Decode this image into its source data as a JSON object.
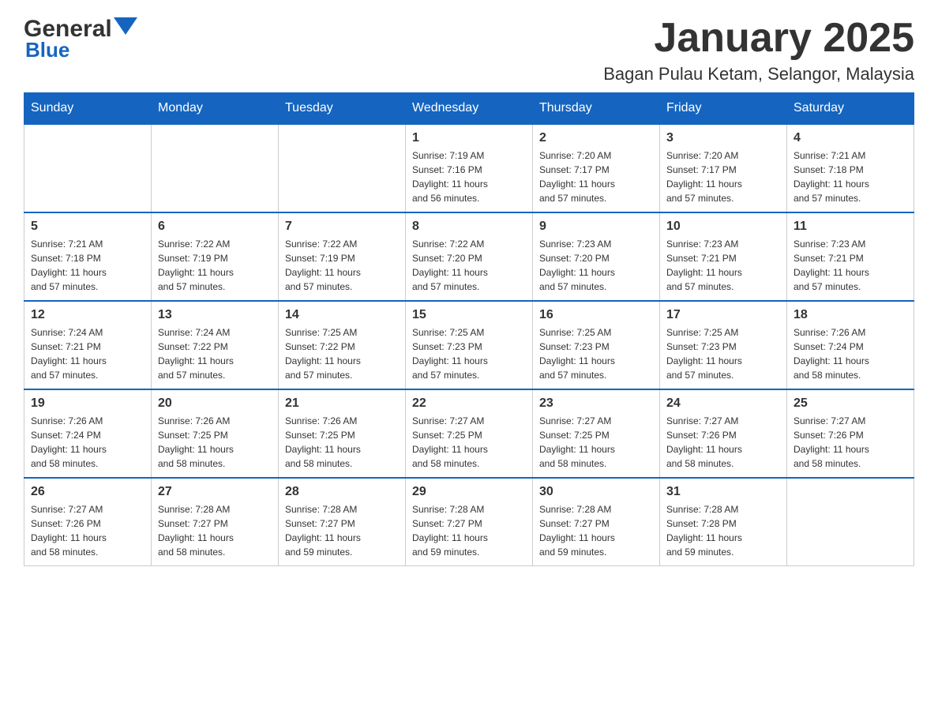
{
  "header": {
    "logo_general": "General",
    "logo_blue": "Blue",
    "title": "January 2025",
    "subtitle": "Bagan Pulau Ketam, Selangor, Malaysia"
  },
  "weekdays": [
    "Sunday",
    "Monday",
    "Tuesday",
    "Wednesday",
    "Thursday",
    "Friday",
    "Saturday"
  ],
  "weeks": [
    [
      {
        "day": "",
        "info": ""
      },
      {
        "day": "",
        "info": ""
      },
      {
        "day": "",
        "info": ""
      },
      {
        "day": "1",
        "info": "Sunrise: 7:19 AM\nSunset: 7:16 PM\nDaylight: 11 hours\nand 56 minutes."
      },
      {
        "day": "2",
        "info": "Sunrise: 7:20 AM\nSunset: 7:17 PM\nDaylight: 11 hours\nand 57 minutes."
      },
      {
        "day": "3",
        "info": "Sunrise: 7:20 AM\nSunset: 7:17 PM\nDaylight: 11 hours\nand 57 minutes."
      },
      {
        "day": "4",
        "info": "Sunrise: 7:21 AM\nSunset: 7:18 PM\nDaylight: 11 hours\nand 57 minutes."
      }
    ],
    [
      {
        "day": "5",
        "info": "Sunrise: 7:21 AM\nSunset: 7:18 PM\nDaylight: 11 hours\nand 57 minutes."
      },
      {
        "day": "6",
        "info": "Sunrise: 7:22 AM\nSunset: 7:19 PM\nDaylight: 11 hours\nand 57 minutes."
      },
      {
        "day": "7",
        "info": "Sunrise: 7:22 AM\nSunset: 7:19 PM\nDaylight: 11 hours\nand 57 minutes."
      },
      {
        "day": "8",
        "info": "Sunrise: 7:22 AM\nSunset: 7:20 PM\nDaylight: 11 hours\nand 57 minutes."
      },
      {
        "day": "9",
        "info": "Sunrise: 7:23 AM\nSunset: 7:20 PM\nDaylight: 11 hours\nand 57 minutes."
      },
      {
        "day": "10",
        "info": "Sunrise: 7:23 AM\nSunset: 7:21 PM\nDaylight: 11 hours\nand 57 minutes."
      },
      {
        "day": "11",
        "info": "Sunrise: 7:23 AM\nSunset: 7:21 PM\nDaylight: 11 hours\nand 57 minutes."
      }
    ],
    [
      {
        "day": "12",
        "info": "Sunrise: 7:24 AM\nSunset: 7:21 PM\nDaylight: 11 hours\nand 57 minutes."
      },
      {
        "day": "13",
        "info": "Sunrise: 7:24 AM\nSunset: 7:22 PM\nDaylight: 11 hours\nand 57 minutes."
      },
      {
        "day": "14",
        "info": "Sunrise: 7:25 AM\nSunset: 7:22 PM\nDaylight: 11 hours\nand 57 minutes."
      },
      {
        "day": "15",
        "info": "Sunrise: 7:25 AM\nSunset: 7:23 PM\nDaylight: 11 hours\nand 57 minutes."
      },
      {
        "day": "16",
        "info": "Sunrise: 7:25 AM\nSunset: 7:23 PM\nDaylight: 11 hours\nand 57 minutes."
      },
      {
        "day": "17",
        "info": "Sunrise: 7:25 AM\nSunset: 7:23 PM\nDaylight: 11 hours\nand 57 minutes."
      },
      {
        "day": "18",
        "info": "Sunrise: 7:26 AM\nSunset: 7:24 PM\nDaylight: 11 hours\nand 58 minutes."
      }
    ],
    [
      {
        "day": "19",
        "info": "Sunrise: 7:26 AM\nSunset: 7:24 PM\nDaylight: 11 hours\nand 58 minutes."
      },
      {
        "day": "20",
        "info": "Sunrise: 7:26 AM\nSunset: 7:25 PM\nDaylight: 11 hours\nand 58 minutes."
      },
      {
        "day": "21",
        "info": "Sunrise: 7:26 AM\nSunset: 7:25 PM\nDaylight: 11 hours\nand 58 minutes."
      },
      {
        "day": "22",
        "info": "Sunrise: 7:27 AM\nSunset: 7:25 PM\nDaylight: 11 hours\nand 58 minutes."
      },
      {
        "day": "23",
        "info": "Sunrise: 7:27 AM\nSunset: 7:25 PM\nDaylight: 11 hours\nand 58 minutes."
      },
      {
        "day": "24",
        "info": "Sunrise: 7:27 AM\nSunset: 7:26 PM\nDaylight: 11 hours\nand 58 minutes."
      },
      {
        "day": "25",
        "info": "Sunrise: 7:27 AM\nSunset: 7:26 PM\nDaylight: 11 hours\nand 58 minutes."
      }
    ],
    [
      {
        "day": "26",
        "info": "Sunrise: 7:27 AM\nSunset: 7:26 PM\nDaylight: 11 hours\nand 58 minutes."
      },
      {
        "day": "27",
        "info": "Sunrise: 7:28 AM\nSunset: 7:27 PM\nDaylight: 11 hours\nand 58 minutes."
      },
      {
        "day": "28",
        "info": "Sunrise: 7:28 AM\nSunset: 7:27 PM\nDaylight: 11 hours\nand 59 minutes."
      },
      {
        "day": "29",
        "info": "Sunrise: 7:28 AM\nSunset: 7:27 PM\nDaylight: 11 hours\nand 59 minutes."
      },
      {
        "day": "30",
        "info": "Sunrise: 7:28 AM\nSunset: 7:27 PM\nDaylight: 11 hours\nand 59 minutes."
      },
      {
        "day": "31",
        "info": "Sunrise: 7:28 AM\nSunset: 7:28 PM\nDaylight: 11 hours\nand 59 minutes."
      },
      {
        "day": "",
        "info": ""
      }
    ]
  ]
}
